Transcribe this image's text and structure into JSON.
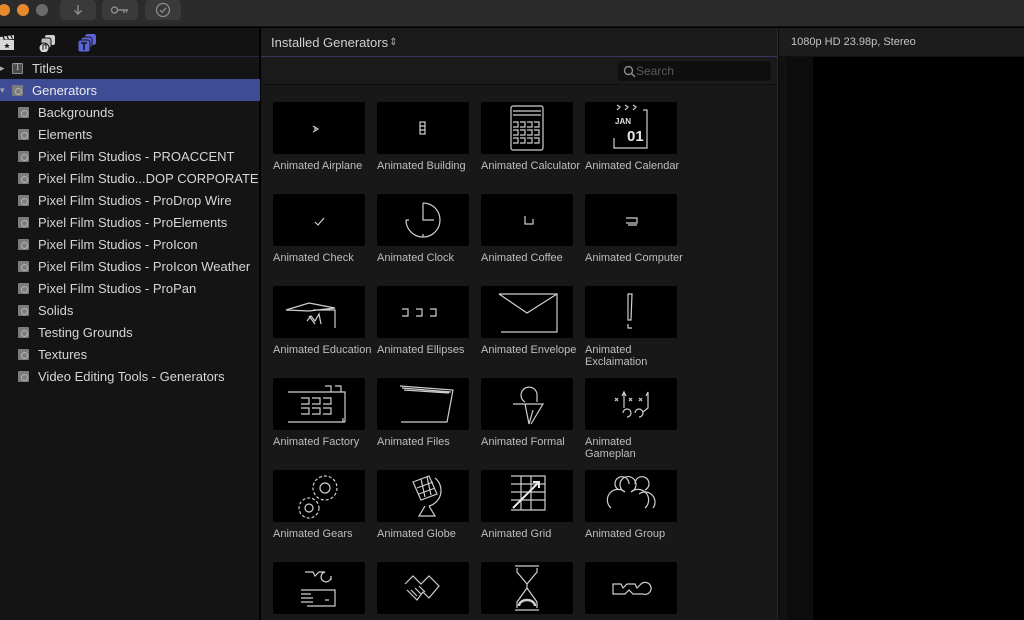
{
  "titlebar": {
    "buttons": [
      {
        "name": "import-button",
        "icon": "download-arrow-icon"
      },
      {
        "name": "keywords-button",
        "icon": "key-icon"
      },
      {
        "name": "background-tasks-button",
        "icon": "checkmark-circle-icon"
      }
    ]
  },
  "sidebar": {
    "toolbar": [
      {
        "name": "libraries-tab",
        "icon": "clapperboard-icon",
        "active": false
      },
      {
        "name": "photos-audio-tab",
        "icon": "photos-music-icon",
        "active": false
      },
      {
        "name": "titles-generators-tab",
        "icon": "titles-generators-icon",
        "active": true
      }
    ],
    "tree": [
      {
        "label": "Titles",
        "level": 0,
        "expanded": false,
        "selected": false,
        "icon": "titles-icon"
      },
      {
        "label": "Generators",
        "level": 0,
        "expanded": true,
        "selected": true,
        "icon": "generator-icon"
      },
      {
        "label": "Backgrounds",
        "level": 1,
        "icon": "generator-icon"
      },
      {
        "label": "Elements",
        "level": 1,
        "icon": "generator-icon"
      },
      {
        "label": "Pixel Film Studios - PROACCENT",
        "level": 1,
        "icon": "generator-icon"
      },
      {
        "label": "Pixel Film Studio...DOP CORPORATE",
        "level": 1,
        "icon": "generator-icon"
      },
      {
        "label": "Pixel Film Studios - ProDrop Wire",
        "level": 1,
        "icon": "generator-icon"
      },
      {
        "label": "Pixel Film Studios - ProElements",
        "level": 1,
        "icon": "generator-icon"
      },
      {
        "label": "Pixel Film Studios - ProIcon",
        "level": 1,
        "icon": "generator-icon"
      },
      {
        "label": "Pixel Film Studios - ProIcon Weather",
        "level": 1,
        "icon": "generator-icon"
      },
      {
        "label": "Pixel Film Studios - ProPan",
        "level": 1,
        "icon": "generator-icon"
      },
      {
        "label": "Solids",
        "level": 1,
        "icon": "generator-icon"
      },
      {
        "label": "Testing Grounds",
        "level": 1,
        "icon": "generator-icon"
      },
      {
        "label": "Textures",
        "level": 1,
        "icon": "generator-icon"
      },
      {
        "label": "Video Editing Tools - Generators",
        "level": 1,
        "icon": "generator-icon"
      }
    ]
  },
  "browser": {
    "title": "Installed Generators",
    "title_chevron": "⌃⌄",
    "search": {
      "value": "",
      "placeholder": "Search"
    },
    "items": [
      {
        "label": "Animated Airplane",
        "thumb": "airplane"
      },
      {
        "label": "Animated Building",
        "thumb": "building"
      },
      {
        "label": "Animated Calculator",
        "thumb": "calculator"
      },
      {
        "label": "Animated Calendar",
        "thumb": "calendar",
        "thumb_text_month": "JAN",
        "thumb_text_day": "01"
      },
      {
        "label": "Animated Check",
        "thumb": "check"
      },
      {
        "label": "Animated Clock",
        "thumb": "clock"
      },
      {
        "label": "Animated Coffee",
        "thumb": "coffee"
      },
      {
        "label": "Animated Computer",
        "thumb": "computer"
      },
      {
        "label": "Animated Education",
        "thumb": "education"
      },
      {
        "label": "Animated Ellipses",
        "thumb": "ellipses"
      },
      {
        "label": "Animated Envelope",
        "thumb": "envelope"
      },
      {
        "label": "Animated Exclaimation",
        "thumb": "exclamation"
      },
      {
        "label": "Animated Factory",
        "thumb": "factory"
      },
      {
        "label": "Animated Files",
        "thumb": "files"
      },
      {
        "label": "Animated Formal",
        "thumb": "formal"
      },
      {
        "label": "Animated Gameplan",
        "thumb": "gameplan"
      },
      {
        "label": "Animated Gears",
        "thumb": "gears"
      },
      {
        "label": "Animated Globe",
        "thumb": "globe"
      },
      {
        "label": "Animated Grid",
        "thumb": "grid"
      },
      {
        "label": "Animated Group",
        "thumb": "group"
      },
      {
        "label": "",
        "thumb": "handshake-money"
      },
      {
        "label": "",
        "thumb": "handshake"
      },
      {
        "label": "",
        "thumb": "hourglass"
      },
      {
        "label": "",
        "thumb": "handshake-outline"
      }
    ]
  },
  "viewer": {
    "format": "1080p HD 23.98p, Stereo"
  },
  "colors": {
    "selection": "#3e4b95",
    "traffic_close": "#e9892d",
    "traffic_min": "#e9892d",
    "traffic_max": "#6a6a6a",
    "active_tab_icon": "#5b63d6"
  }
}
